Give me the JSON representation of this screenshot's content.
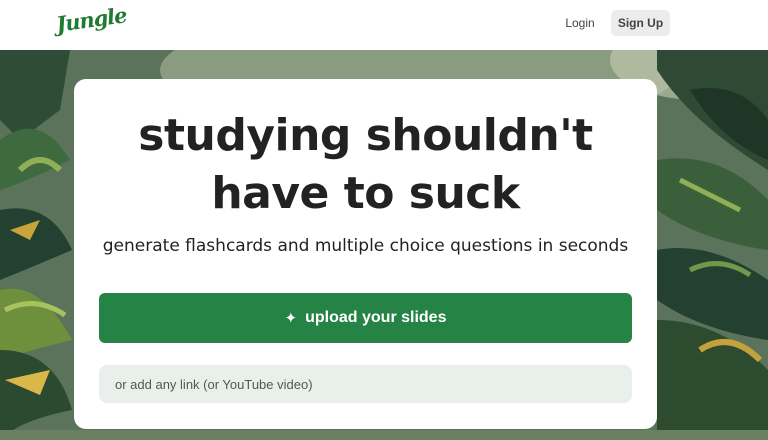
{
  "header": {
    "logo_text": "Jungle",
    "login_label": "Login",
    "signup_label": "Sign Up"
  },
  "hero": {
    "headline_line1": "studying shouldn't",
    "headline_line2": "have to suck",
    "subheadline": "generate flashcards and multiple choice questions in seconds",
    "upload_icon": "sparkle-icon",
    "upload_label": "upload your slides",
    "link_placeholder": "or add any link (or YouTube video)"
  },
  "colors": {
    "brand": "#1f7a33",
    "primary_button": "#268346",
    "input_bg": "#e9f0ec"
  }
}
